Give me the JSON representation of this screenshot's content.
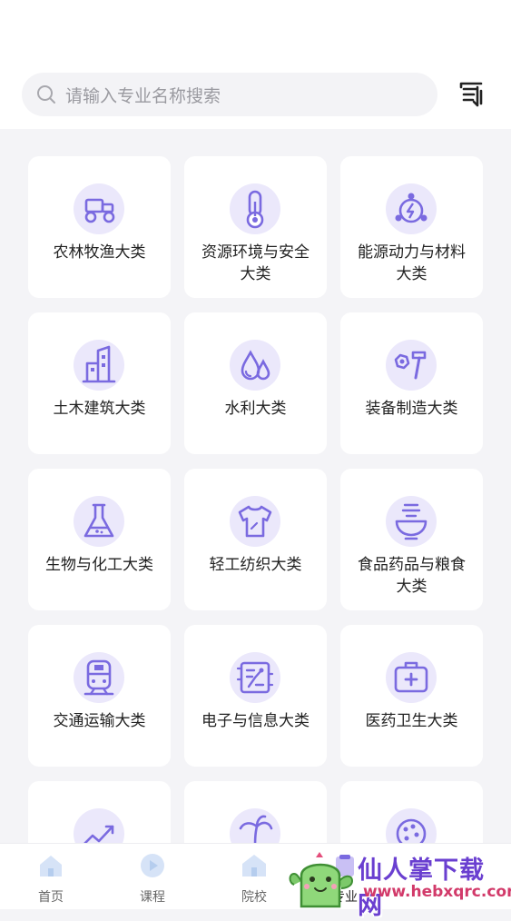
{
  "search": {
    "placeholder": "请输入专业名称搜索"
  },
  "categories": [
    {
      "label": "农林牧渔大类",
      "icon": "tractor-icon"
    },
    {
      "label": "资源环境与安全大类",
      "icon": "thermometer-icon"
    },
    {
      "label": "能源动力与材料大类",
      "icon": "energy-molecule-icon"
    },
    {
      "label": "土木建筑大类",
      "icon": "buildings-icon"
    },
    {
      "label": "水利大类",
      "icon": "water-drops-icon"
    },
    {
      "label": "装备制造大类",
      "icon": "tools-icon"
    },
    {
      "label": "生物与化工大类",
      "icon": "flask-icon"
    },
    {
      "label": "轻工纺织大类",
      "icon": "shirt-icon"
    },
    {
      "label": "食品药品与粮食大类",
      "icon": "food-bowl-icon"
    },
    {
      "label": "交通运输大类",
      "icon": "train-icon"
    },
    {
      "label": "电子与信息大类",
      "icon": "circuit-board-icon"
    },
    {
      "label": "医药卫生大类",
      "icon": "medical-kit-icon"
    },
    {
      "label": "",
      "icon": "trend-chart-icon"
    },
    {
      "label": "",
      "icon": "palm-tree-icon"
    },
    {
      "label": "",
      "icon": "palette-icon"
    }
  ],
  "tabbar": {
    "tabs": [
      {
        "label": "首页",
        "icon": "home-icon"
      },
      {
        "label": "课程",
        "icon": "play-icon"
      },
      {
        "label": "院校",
        "icon": "school-icon"
      },
      {
        "label": "专业",
        "icon": "major-icon"
      }
    ]
  },
  "watermark": {
    "text": "仙人掌下载网",
    "url": "www.hebxqrc.com"
  },
  "colors": {
    "accent": "#7a6ae0",
    "accent_light": "#ebe8fb",
    "card": "#ffffff",
    "background": "#f4f4f7"
  }
}
